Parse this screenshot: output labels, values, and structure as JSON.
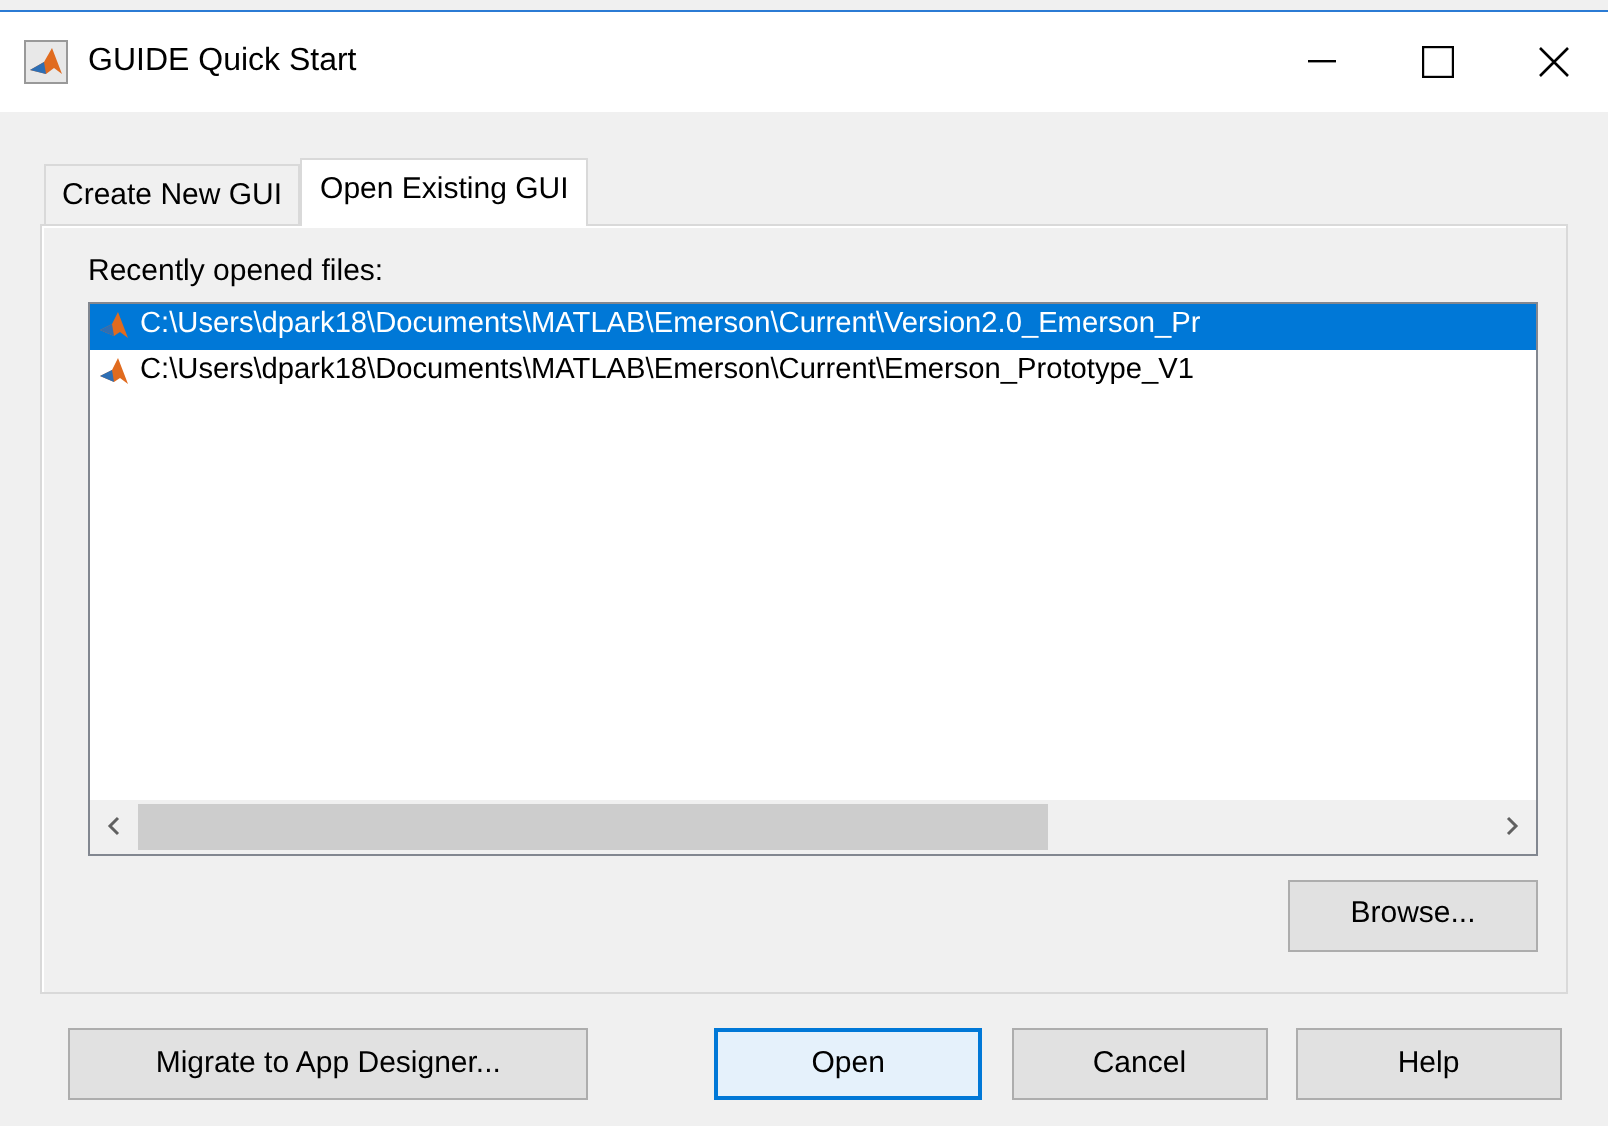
{
  "window": {
    "title": "GUIDE Quick Start"
  },
  "tabs": [
    {
      "label": "Create New GUI",
      "selected": false
    },
    {
      "label": "Open Existing GUI",
      "selected": true
    }
  ],
  "recent_files": {
    "label": "Recently opened files:",
    "items": [
      {
        "path": "C:\\Users\\dpark18\\Documents\\MATLAB\\Emerson\\Current\\Version2.0_Emerson_Pr",
        "selected": true
      },
      {
        "path": "C:\\Users\\dpark18\\Documents\\MATLAB\\Emerson\\Current\\Emerson_Prototype_V1",
        "selected": false
      }
    ]
  },
  "browse_button": "Browse...",
  "buttons": [
    {
      "label": "Migrate to App Designer...",
      "default": false
    },
    {
      "label": "Open",
      "default": true
    },
    {
      "label": "Cancel",
      "default": false
    },
    {
      "label": "Help",
      "default": false
    }
  ]
}
